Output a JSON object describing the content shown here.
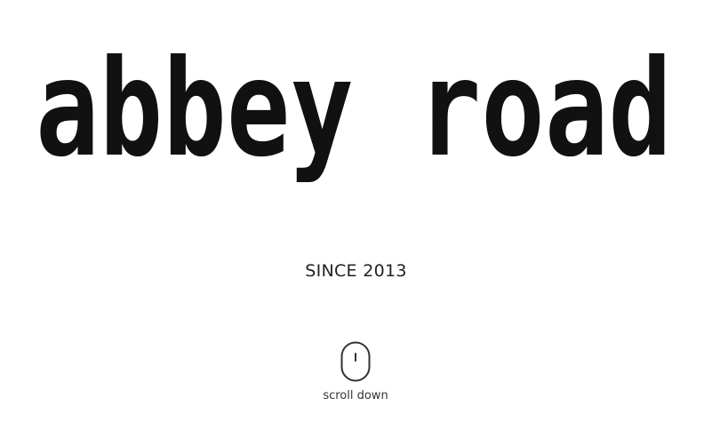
{
  "hero": {
    "logo_text": "abbey road",
    "tagline": "SINCE 2013",
    "scroll": {
      "icon": "mouse-icon",
      "label": "scroll down"
    }
  },
  "colors": {
    "background": "#ffffff",
    "logo": "#111111",
    "text": "#222222"
  }
}
